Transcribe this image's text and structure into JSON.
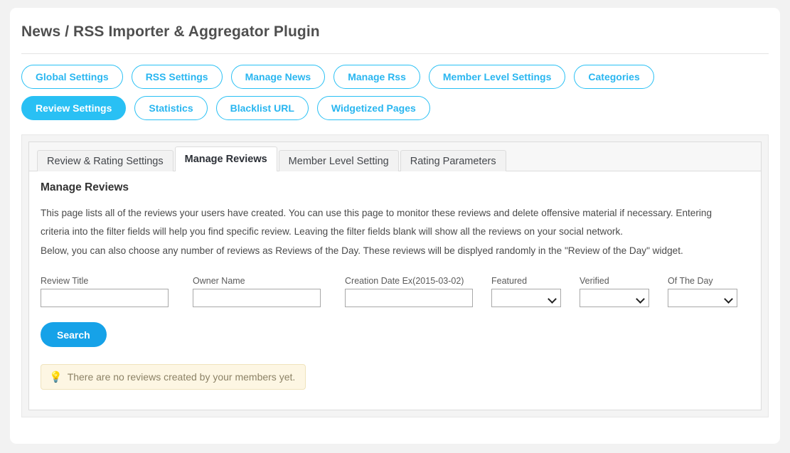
{
  "page": {
    "title": "News / RSS Importer & Aggregator Plugin"
  },
  "pill_nav": {
    "items": [
      {
        "label": "Global Settings",
        "active": false
      },
      {
        "label": "RSS Settings",
        "active": false
      },
      {
        "label": "Manage News",
        "active": false
      },
      {
        "label": "Manage Rss",
        "active": false
      },
      {
        "label": "Member Level Settings",
        "active": false
      },
      {
        "label": "Categories",
        "active": false
      },
      {
        "label": "Review Settings",
        "active": true
      },
      {
        "label": "Statistics",
        "active": false
      },
      {
        "label": "Blacklist URL",
        "active": false
      },
      {
        "label": "Widgetized Pages",
        "active": false
      }
    ]
  },
  "subtabs": {
    "items": [
      {
        "label": "Review & Rating Settings",
        "active": false
      },
      {
        "label": "Manage Reviews",
        "active": true
      },
      {
        "label": "Member Level Setting",
        "active": false
      },
      {
        "label": "Rating Parameters",
        "active": false
      }
    ]
  },
  "content": {
    "section_title": "Manage Reviews",
    "paragraph_1": "This page lists all of the reviews your users have created. You can use this page to monitor these reviews and delete offensive material if necessary. Entering criteria into the filter fields will help you find specific review. Leaving the filter fields blank will show all the reviews on your social network.",
    "paragraph_2": "Below, you can also choose any number of reviews as Reviews of the Day. These reviews will be displyed randomly in the \"Review of the Day\" widget."
  },
  "filters": {
    "review_title": {
      "label": "Review Title",
      "value": "",
      "placeholder": ""
    },
    "owner_name": {
      "label": "Owner Name",
      "value": "",
      "placeholder": ""
    },
    "creation_date": {
      "label": "Creation Date Ex(2015-03-02)",
      "value": "",
      "placeholder": ""
    },
    "featured": {
      "label": "Featured",
      "selected": ""
    },
    "verified": {
      "label": "Verified",
      "selected": ""
    },
    "of_the_day": {
      "label": "Of The Day",
      "selected": ""
    },
    "search_button": "Search"
  },
  "notice": {
    "icon": "lightbulb-icon",
    "glyph": "💡",
    "message": "There are no reviews created by your members yet."
  },
  "colors": {
    "accent_cyan": "#29c0f4",
    "button_blue": "#16a2e8",
    "notice_bg": "#fdf6e3",
    "notice_border": "#f0e3bd",
    "notice_text": "#8c8266",
    "page_bg": "#f2f2f2"
  }
}
